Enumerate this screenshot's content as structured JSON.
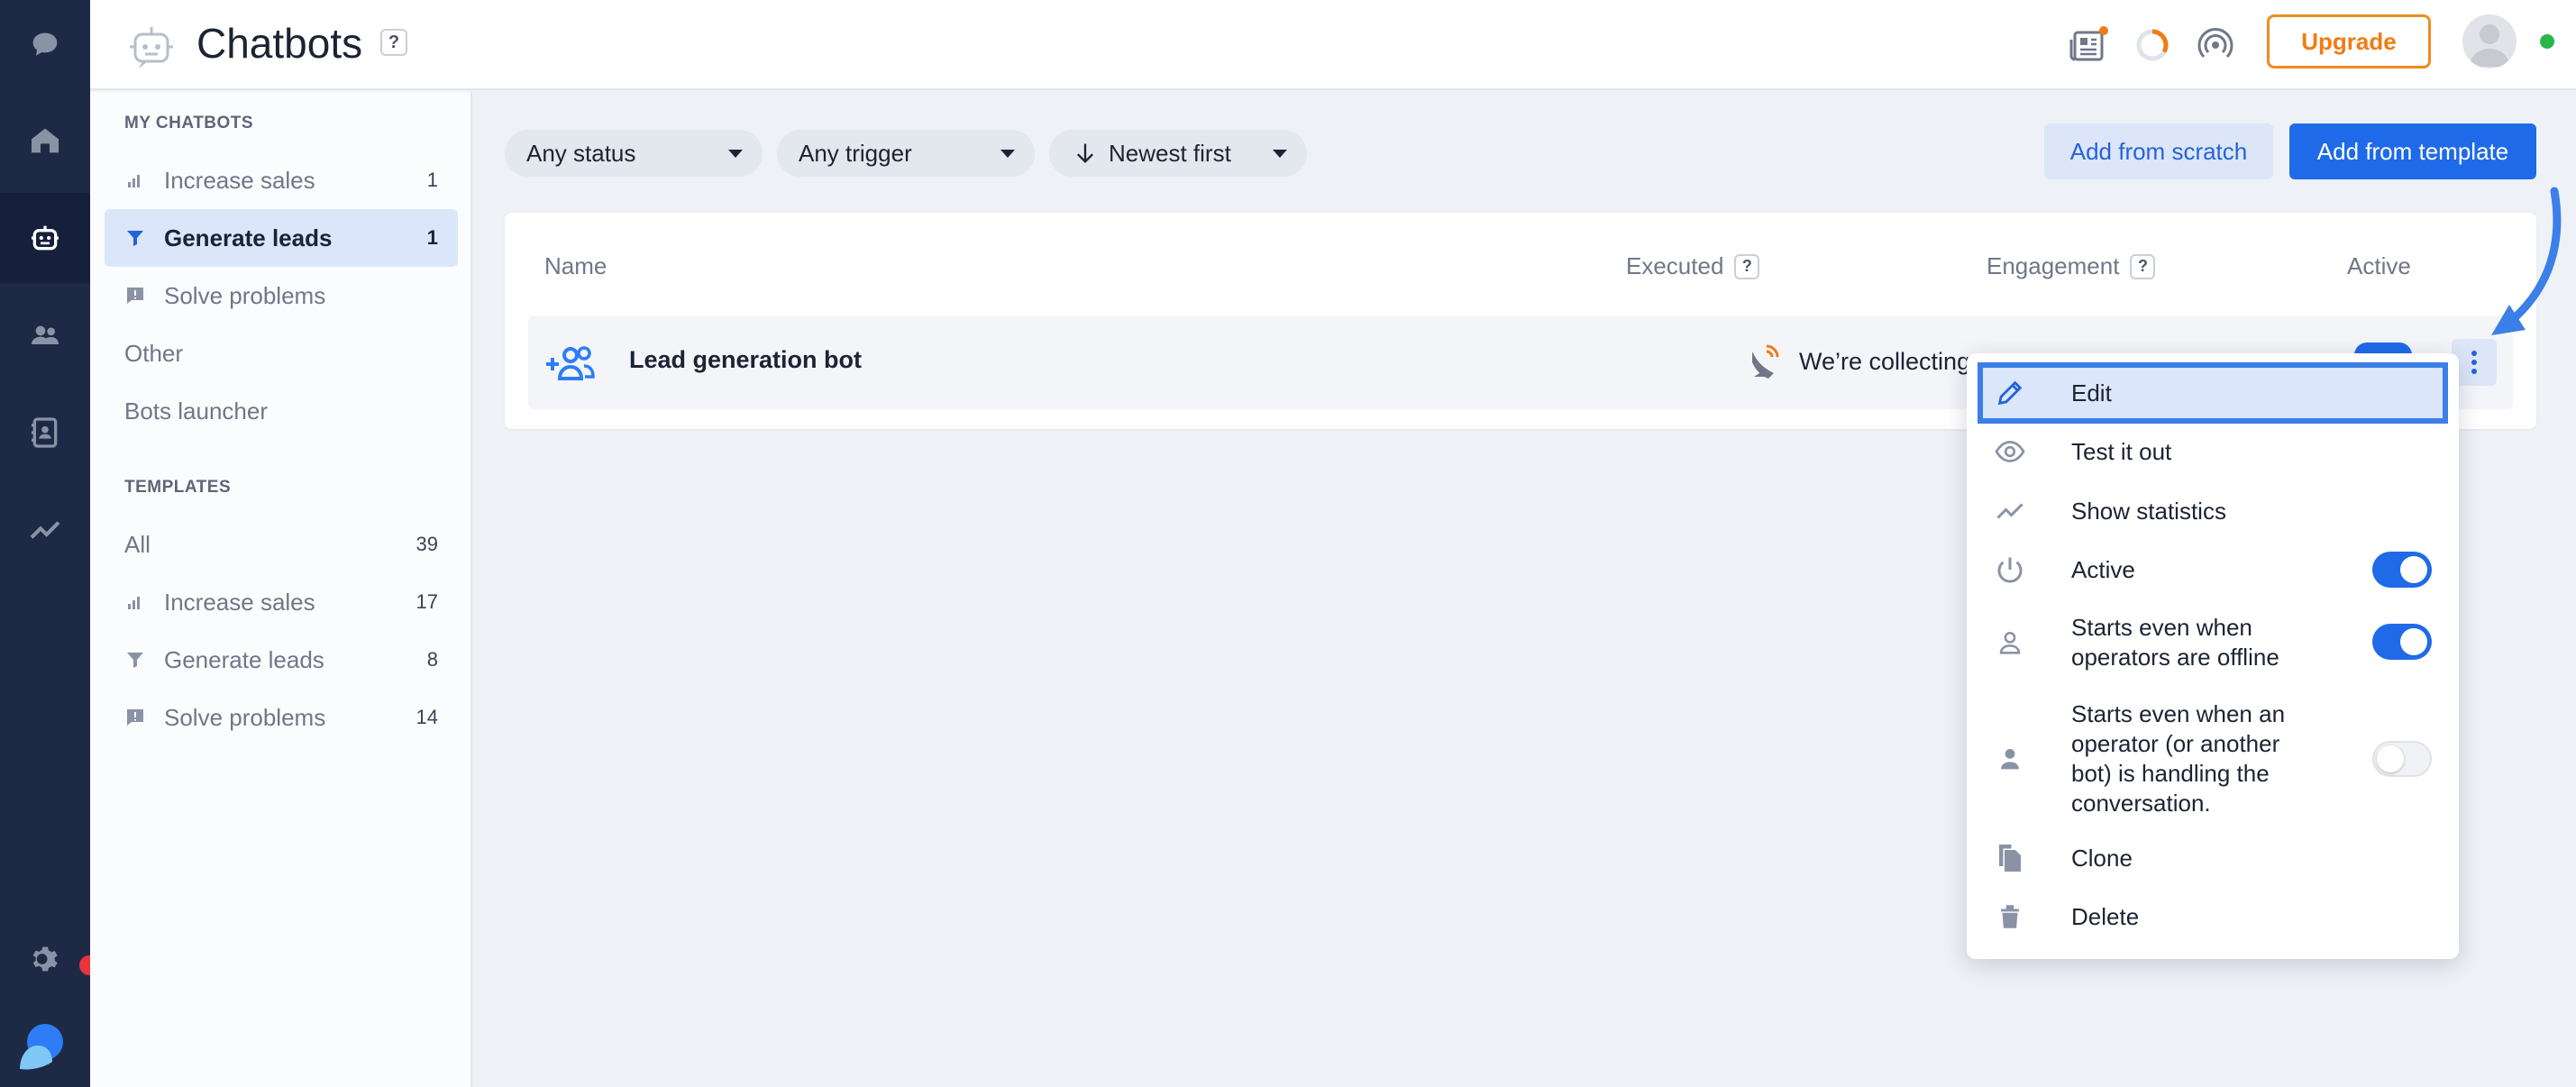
{
  "header": {
    "title": "Chatbots",
    "help_badge": "?",
    "upgrade_label": "Upgrade"
  },
  "sidebar": {
    "my_chatbots_heading": "MY CHATBOTS",
    "my_chatbots": [
      {
        "label": "Increase sales",
        "count": "1"
      },
      {
        "label": "Generate leads",
        "count": "1",
        "active": true
      },
      {
        "label": "Solve problems",
        "count": ""
      },
      {
        "label": "Other",
        "count": ""
      },
      {
        "label": "Bots launcher",
        "count": ""
      }
    ],
    "templates_heading": "TEMPLATES",
    "templates": [
      {
        "label": "All",
        "count": "39"
      },
      {
        "label": "Increase sales",
        "count": "17"
      },
      {
        "label": "Generate leads",
        "count": "8"
      },
      {
        "label": "Solve problems",
        "count": "14"
      }
    ]
  },
  "filters": {
    "status": "Any status",
    "trigger": "Any trigger",
    "sort": "Newest first"
  },
  "actions": {
    "add_scratch": "Add from scratch",
    "add_template": "Add from template"
  },
  "table": {
    "columns": {
      "name": "Name",
      "executed": "Executed",
      "engagement": "Engagement",
      "active": "Active"
    },
    "help_badge": "?",
    "rows": [
      {
        "name": "Lead generation bot",
        "executed": "We’re collecting data"
      }
    ]
  },
  "menu": {
    "items": [
      {
        "label": "Edit"
      },
      {
        "label": "Test it out"
      },
      {
        "label": "Show statistics"
      },
      {
        "label": "Active",
        "toggle": "on"
      },
      {
        "label_line1": "Starts even when",
        "label_line2": "operators are offline",
        "toggle": "on"
      },
      {
        "label_line1": "Starts even when an",
        "label_line2": "operator (or another",
        "label_line3": "bot) is handling the",
        "label_line4": "conversation.",
        "toggle": "off"
      },
      {
        "label": "Clone"
      },
      {
        "label": "Delete"
      }
    ]
  },
  "colors": {
    "rail": "#1e2a45",
    "accent": "#1f6ae8",
    "upgrade": "#f07b14",
    "highlight_border": "#3b7fe8"
  }
}
